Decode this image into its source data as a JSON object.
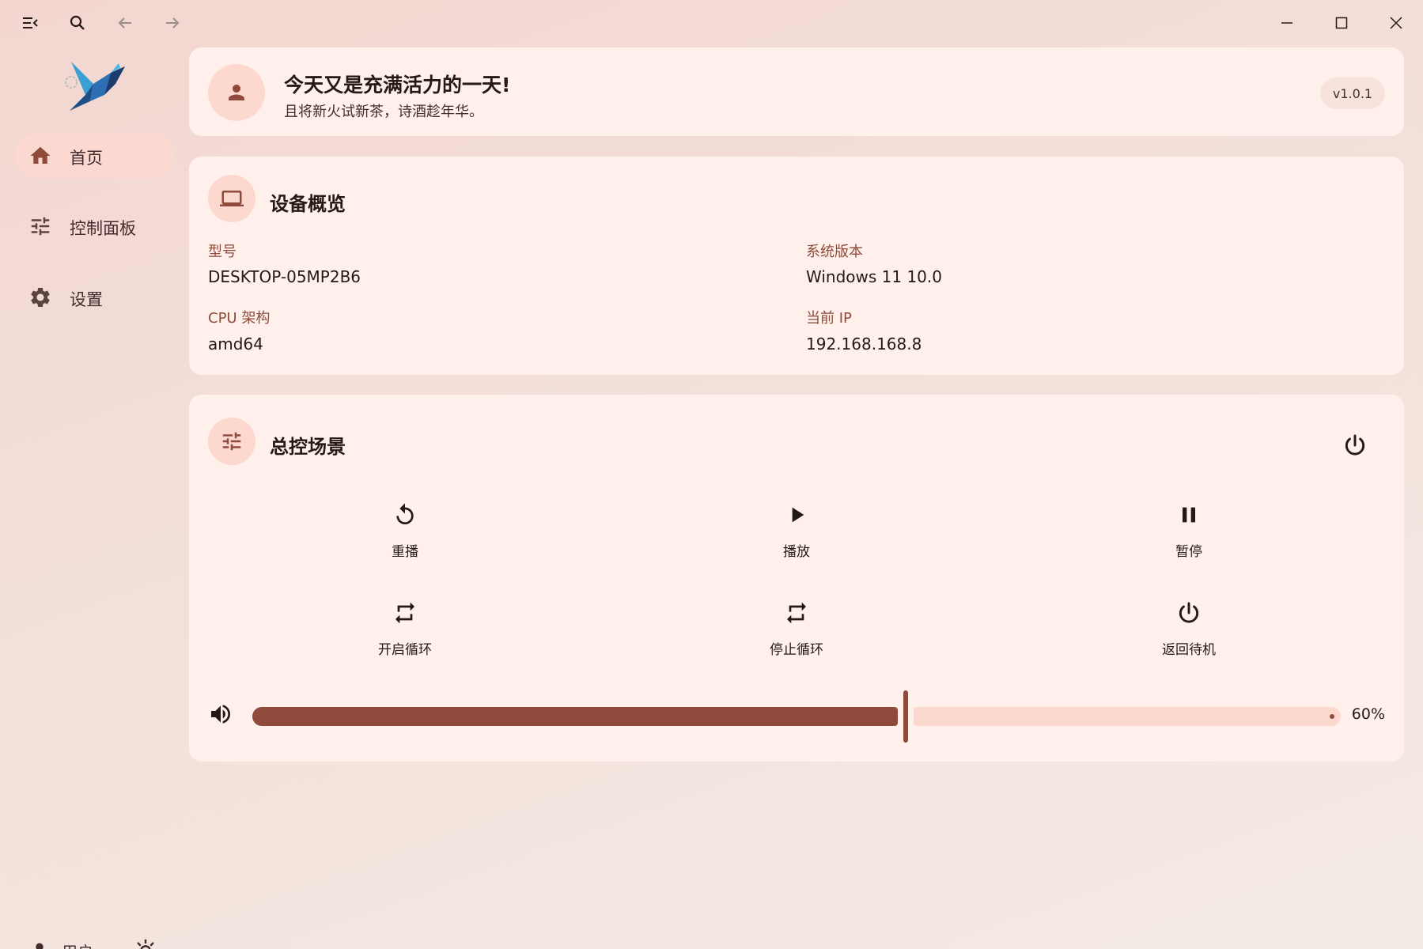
{
  "window": {
    "controls": [
      "minimize-icon",
      "maximize-icon",
      "close-icon"
    ]
  },
  "colors": {
    "primary": "#8f4a3b",
    "primary_container": "#fcd8cf",
    "card": "#fff0ec",
    "label": "#8e4b3b"
  },
  "sidebar": {
    "items": [
      {
        "label": "首页",
        "icon": "home-icon",
        "active": true
      },
      {
        "label": "控制面板",
        "icon": "tune-icon",
        "active": false
      },
      {
        "label": "设置",
        "icon": "gear-icon",
        "active": false
      }
    ],
    "user_label": "用户"
  },
  "greeting": {
    "title": "今天又是充满活力的一天!",
    "subtitle": "且将新火试新茶，诗酒趁年华。",
    "version": "v1.0.1"
  },
  "device": {
    "title": "设备概览",
    "fields": [
      {
        "label": "型号",
        "value": "DESKTOP-05MP2B6"
      },
      {
        "label": "系统版本",
        "value": "Windows 11 10.0"
      },
      {
        "label": "CPU 架构",
        "value": "amd64"
      },
      {
        "label": "当前 IP",
        "value": "192.168.168.8"
      }
    ]
  },
  "scene": {
    "title": "总控场景",
    "controls": [
      {
        "label": "重播",
        "icon": "replay-icon"
      },
      {
        "label": "播放",
        "icon": "play-icon"
      },
      {
        "label": "暂停",
        "icon": "pause-icon"
      },
      {
        "label": "开启循环",
        "icon": "repeat-icon"
      },
      {
        "label": "停止循环",
        "icon": "repeat-icon"
      },
      {
        "label": "返回待机",
        "icon": "power-icon"
      }
    ],
    "volume": {
      "value": 0.6,
      "label": "60%"
    }
  }
}
